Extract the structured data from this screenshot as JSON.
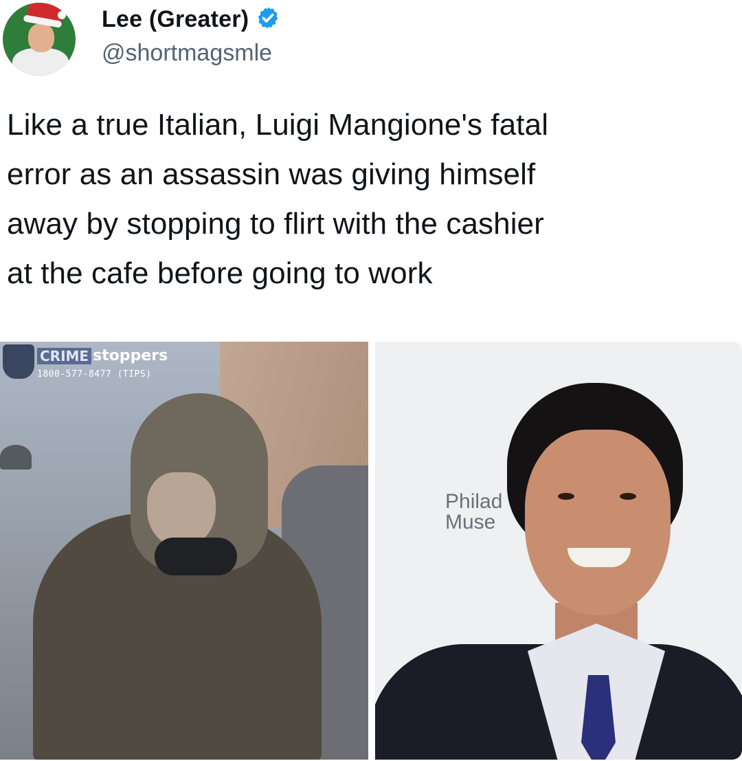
{
  "tweet": {
    "author": {
      "display_name": "Lee (Greater)",
      "handle": "@shortmagsmle",
      "verified_icon": "verified-badge-icon",
      "avatar": "profile-photo-santa-hat"
    },
    "text": "Like a true Italian, Luigi Mangione's fatal\nerror as an assassin was giving himself\naway by stopping to flirt with the cashier\nat the cafe before going to work",
    "media": {
      "left": {
        "overlay_brand_crime": "CRIME",
        "overlay_brand_stoppers": "stoppers",
        "overlay_phone": "1800-577-8477 (TIPS)"
      },
      "right": {
        "backdrop_text_line1": "Philad",
        "backdrop_text_line2": "Muse"
      }
    },
    "colors": {
      "verified": "#1d9bf0",
      "handle": "#536471",
      "text": "#0f1419"
    }
  }
}
